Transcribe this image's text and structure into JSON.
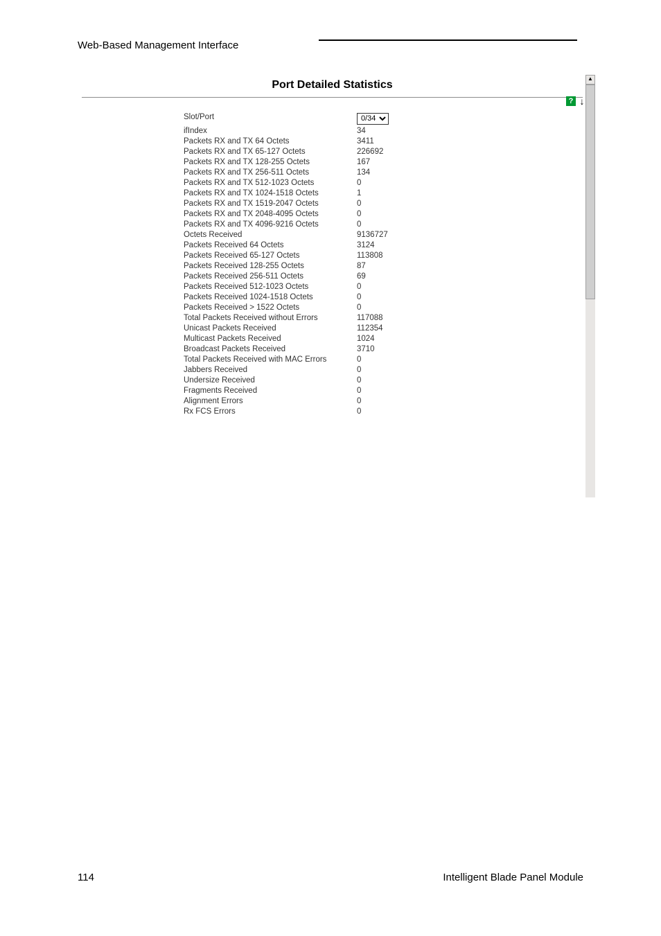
{
  "header": {
    "title": "Web-Based Management Interface"
  },
  "panel": {
    "title": "Port Detailed Statistics",
    "help_label": "?",
    "down_arrow": "↓",
    "scroll_up": "▲"
  },
  "slot_port": {
    "label": "Slot/Port",
    "selected": "0/34"
  },
  "stats": [
    {
      "label": "ifIndex",
      "value": "34"
    },
    {
      "label": "Packets RX and TX 64 Octets",
      "value": "3411"
    },
    {
      "label": "Packets RX and TX 65-127 Octets",
      "value": "226692"
    },
    {
      "label": "Packets RX and TX 128-255 Octets",
      "value": "167"
    },
    {
      "label": "Packets RX and TX 256-511 Octets",
      "value": "134"
    },
    {
      "label": "Packets RX and TX 512-1023 Octets",
      "value": "0"
    },
    {
      "label": "Packets RX and TX 1024-1518 Octets",
      "value": "1"
    },
    {
      "label": "Packets RX and TX 1519-2047 Octets",
      "value": "0"
    },
    {
      "label": "Packets RX and TX 2048-4095 Octets",
      "value": "0"
    },
    {
      "label": "Packets RX and TX 4096-9216 Octets",
      "value": "0"
    },
    {
      "label": "Octets Received",
      "value": "9136727"
    },
    {
      "label": "Packets Received 64 Octets",
      "value": "3124"
    },
    {
      "label": "Packets Received 65-127 Octets",
      "value": "113808"
    },
    {
      "label": "Packets Received 128-255 Octets",
      "value": "87"
    },
    {
      "label": "Packets Received 256-511 Octets",
      "value": "69"
    },
    {
      "label": "Packets Received 512-1023 Octets",
      "value": "0"
    },
    {
      "label": "Packets Received 1024-1518 Octets",
      "value": "0"
    },
    {
      "label": "Packets Received > 1522 Octets",
      "value": "0"
    },
    {
      "label": "Total Packets Received without Errors",
      "value": "117088"
    },
    {
      "label": "Unicast Packets Received",
      "value": "112354"
    },
    {
      "label": "Multicast Packets Received",
      "value": "1024"
    },
    {
      "label": "Broadcast Packets Received",
      "value": "3710"
    },
    {
      "label": "Total Packets Received with MAC Errors",
      "value": "0"
    },
    {
      "label": "Jabbers Received",
      "value": "0"
    },
    {
      "label": "Undersize Received",
      "value": "0"
    },
    {
      "label": "Fragments Received",
      "value": "0"
    },
    {
      "label": "Alignment Errors",
      "value": "0"
    },
    {
      "label": "Rx FCS Errors",
      "value": "0"
    }
  ],
  "footer": {
    "page_number": "114",
    "product": "Intelligent Blade Panel Module"
  }
}
